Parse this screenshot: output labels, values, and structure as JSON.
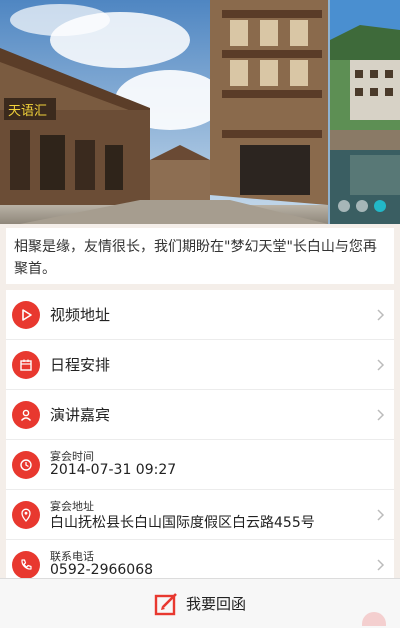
{
  "intro": {
    "text": "相聚是缘，友情很长，我们期盼在\"梦幻天堂\"长白山与您再聚首。"
  },
  "carousel": {
    "sign_text": "天语汇",
    "dot_count": 3,
    "active_index": 2
  },
  "menu": [
    {
      "label": "视频地址",
      "icon": "play-icon"
    },
    {
      "label": "日程安排",
      "icon": "calendar-icon"
    },
    {
      "label": "演讲嘉宾",
      "icon": "person-icon"
    }
  ],
  "info": {
    "time": {
      "title": "宴会时间",
      "value": "2014-07-31 09:27",
      "icon": "clock-icon"
    },
    "address": {
      "title": "宴会地址",
      "value": "白山抚松县长白山国际度假区白云路455号",
      "icon": "location-pin-icon"
    },
    "phone": {
      "title": "联系电话",
      "value": "0592-2966068",
      "icon": "phone-icon"
    }
  },
  "bottom_bar": {
    "rsvp_label": "我要回函",
    "icon": "edit-icon"
  },
  "colors": {
    "accent": "#e8382f",
    "dot_active": "#22b8c8",
    "background": "#f4eee9"
  }
}
